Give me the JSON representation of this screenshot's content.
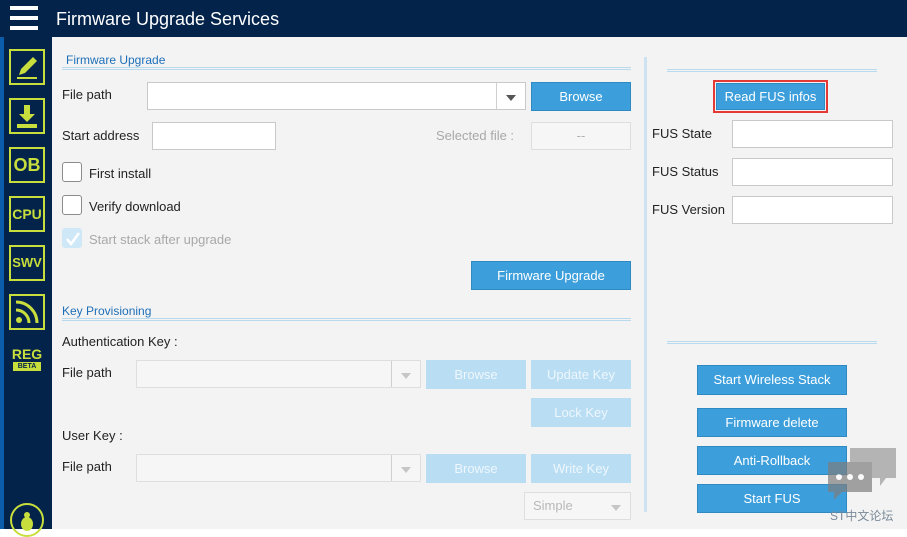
{
  "app": {
    "title": "Firmware Upgrade Services"
  },
  "sidebar": {
    "items": [
      {
        "icon": "edit-icon"
      },
      {
        "icon": "download-icon"
      },
      {
        "icon": "option-bytes-icon",
        "label": "OB"
      },
      {
        "icon": "cpu-icon",
        "label": "CPU"
      },
      {
        "icon": "swv-icon",
        "label": "SWV"
      },
      {
        "icon": "rss-icon"
      },
      {
        "icon": "reg-icon",
        "label": "REG",
        "sublabel": "BETA"
      }
    ],
    "accent_color": "#c8de3c"
  },
  "firmware_upgrade": {
    "section_title": "Firmware Upgrade",
    "file_path_label": "File path",
    "file_path_value": "",
    "browse_label": "Browse",
    "start_address_label": "Start address",
    "start_address_value": "",
    "selected_file_label": "Selected file :",
    "selected_file_value": "--",
    "first_install_label": "First install",
    "first_install_checked": false,
    "verify_download_label": "Verify download",
    "verify_download_checked": false,
    "start_stack_label": "Start stack after upgrade",
    "start_stack_checked": true,
    "upgrade_button": "Firmware Upgrade"
  },
  "key_provisioning": {
    "section_title": "Key Provisioning",
    "auth_key_label": "Authentication Key :",
    "auth_file_path_label": "File path",
    "auth_browse_label": "Browse",
    "update_key_label": "Update Key",
    "lock_key_label": "Lock Key",
    "user_key_label": "User Key :",
    "user_file_path_label": "File path",
    "user_browse_label": "Browse",
    "write_key_label": "Write Key",
    "key_type_value": "Simple"
  },
  "fus": {
    "read_button": "Read FUS infos",
    "state_label": "FUS State",
    "state_value": "",
    "status_label": "FUS Status",
    "status_value": "",
    "version_label": "FUS Version",
    "version_value": ""
  },
  "actions": {
    "start_wireless_stack": "Start Wireless Stack",
    "firmware_delete": "Firmware delete",
    "anti_rollback": "Anti-Rollback",
    "start_fus": "Start FUS"
  },
  "watermark": {
    "text": "ST中文论坛"
  },
  "colors": {
    "header_bg": "#03234b",
    "button": "#3c9fdc",
    "highlight": "#e53935"
  }
}
